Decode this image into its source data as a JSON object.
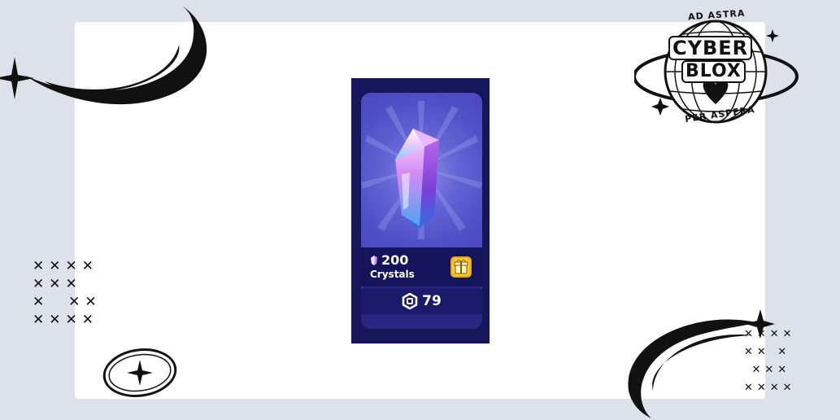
{
  "product": {
    "amount": "200",
    "name": "Crystals",
    "price": "79",
    "currency_icon": "robux-icon",
    "gift_icon": "gift-icon",
    "item_icon": "crystal-icon"
  },
  "branding": {
    "top_text": "AD ASTRA",
    "word_1": "CYBER",
    "word_2": "BLOX",
    "bottom_text": "PER ASPERA"
  },
  "colors": {
    "card_bg": "#2a2783",
    "card_top": "#5250c6",
    "info_bg": "#15135a",
    "gift": "#f0c020"
  }
}
